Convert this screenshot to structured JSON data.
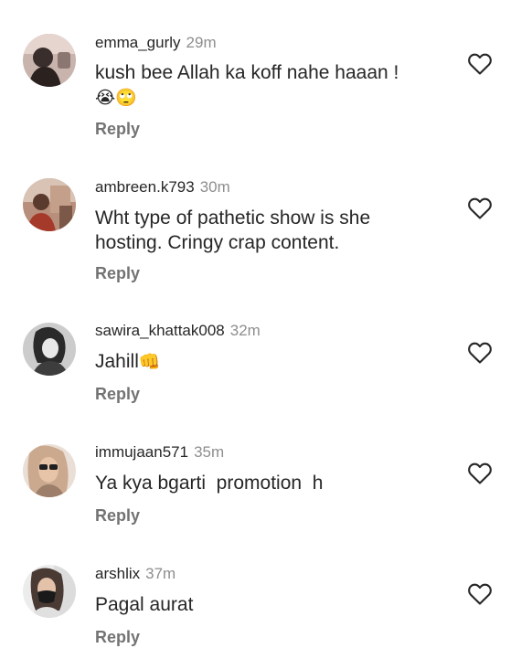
{
  "comments": [
    {
      "username": "emma_gurly",
      "time": "29m",
      "text": "kush bee Allah ka koff nahe haaan !",
      "emojis": "😭🙄",
      "reply_label": "Reply",
      "avatar_icon": "profile-photo"
    },
    {
      "username": "ambreen.k793",
      "time": "30m",
      "text": "Wht type of pathetic show is she hosting. Cringy crap content.",
      "reply_label": "Reply",
      "avatar_icon": "profile-photo"
    },
    {
      "username": "sawira_khattak008",
      "time": "32m",
      "text": "Jahill",
      "emojis": "👊",
      "reply_label": "Reply",
      "avatar_icon": "profile-photo"
    },
    {
      "username": "immujaan571",
      "time": "35m",
      "text": "Ya kya bgarti  promotion  h",
      "reply_label": "Reply",
      "avatar_icon": "profile-photo"
    },
    {
      "username": "arshlix",
      "time": "37m",
      "text": "Pagal aurat",
      "reply_label": "Reply",
      "avatar_icon": "profile-photo"
    }
  ],
  "icons": {
    "like": "heart-outline-icon"
  },
  "colors": {
    "text": "#262626",
    "muted": "#8e8e8e",
    "reply": "#737373"
  }
}
